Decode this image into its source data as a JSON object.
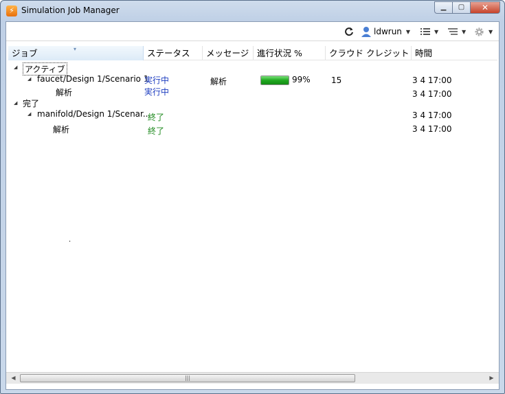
{
  "window": {
    "title": "Simulation Job Manager",
    "app_icon": "app-logo-icon",
    "caption": {
      "minimize": "minimize-icon",
      "maximize": "maximize-icon",
      "close": "close-icon"
    }
  },
  "toolbar": {
    "refresh_icon": "refresh-icon",
    "user_name": "ldwrun",
    "user_icon": "user-icon",
    "list_icon": "list-view-icon",
    "filter_icon": "filter-list-icon",
    "settings_icon": "gear-icon"
  },
  "columns": {
    "job": "ジョブ",
    "status": "ステータス",
    "message": "メッセージ",
    "progress": "進行状況 %",
    "credit": "クラウド クレジット",
    "time": "時間"
  },
  "rows": [
    {
      "job": "アクティブ",
      "status": "",
      "message": "",
      "progress_text": "",
      "credit": "",
      "time": ""
    },
    {
      "job": "faucet/Design 1/Scenario 1",
      "status": "実行中",
      "message": "解析",
      "progress_text": "99%",
      "progress_value": 0.99,
      "credit": "15",
      "time": "3 4 17:00"
    },
    {
      "job": "解析",
      "status": "実行中",
      "message": "",
      "progress_text": "",
      "credit": "",
      "time": "3 4 17:00"
    },
    {
      "job": "完了",
      "status": "",
      "message": "",
      "progress_text": "",
      "credit": "",
      "time": ""
    },
    {
      "job": "manifold/Design 1/Scenar...",
      "status": "終了",
      "message": "",
      "progress_text": "",
      "credit": "",
      "time": "3 4 17:00"
    },
    {
      "job": "解析",
      "status": "終了",
      "message": "",
      "progress_text": "",
      "credit": "",
      "time": "3 4 17:00"
    }
  ],
  "colors": {
    "running": "#1b3bbf",
    "done": "#1f8a1f",
    "progress_fill": "#21a821"
  }
}
